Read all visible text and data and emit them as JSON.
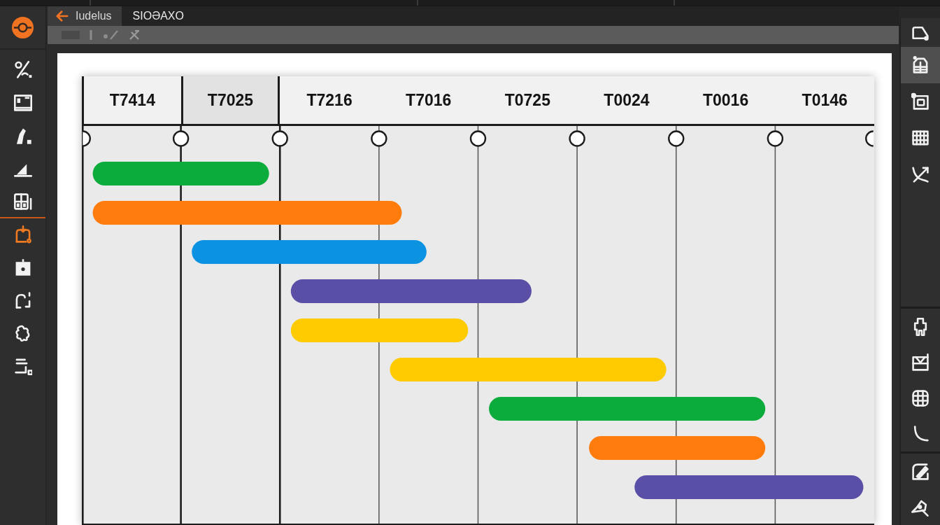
{
  "tabs": [
    {
      "label": "Iudelus",
      "selected": true
    },
    {
      "label": "SIOƏAXO",
      "selected": false
    }
  ],
  "left_toolbar": {
    "items": [
      {
        "selected": false
      },
      {
        "selected": false
      },
      {
        "selected": false
      },
      {
        "selected": false
      },
      {
        "selected": false
      },
      {
        "selected": true
      },
      {
        "selected": false
      },
      {
        "selected": false
      },
      {
        "selected": false
      },
      {
        "selected": false
      }
    ]
  },
  "gantt": {
    "columns": [
      {
        "label": "T7414",
        "selected": false
      },
      {
        "label": "T7025",
        "selected": true
      },
      {
        "label": "T7216",
        "selected": false
      },
      {
        "label": "T7016",
        "selected": false
      },
      {
        "label": "T0725",
        "selected": false
      },
      {
        "label": "T0024",
        "selected": false
      },
      {
        "label": "T0016",
        "selected": false
      },
      {
        "label": "T0146",
        "selected": false
      }
    ]
  },
  "right_toolbar": {
    "groups": [
      {
        "items": [
          {
            "selected": false
          },
          {
            "selected": true
          },
          {
            "selected": false
          },
          {
            "selected": false
          },
          {
            "selected": false
          }
        ]
      },
      {
        "items": [
          {
            "selected": false
          },
          {
            "selected": false
          },
          {
            "selected": false
          },
          {
            "selected": false
          }
        ]
      },
      {
        "items": [
          {
            "selected": false
          },
          {
            "selected": false
          }
        ]
      }
    ]
  }
}
